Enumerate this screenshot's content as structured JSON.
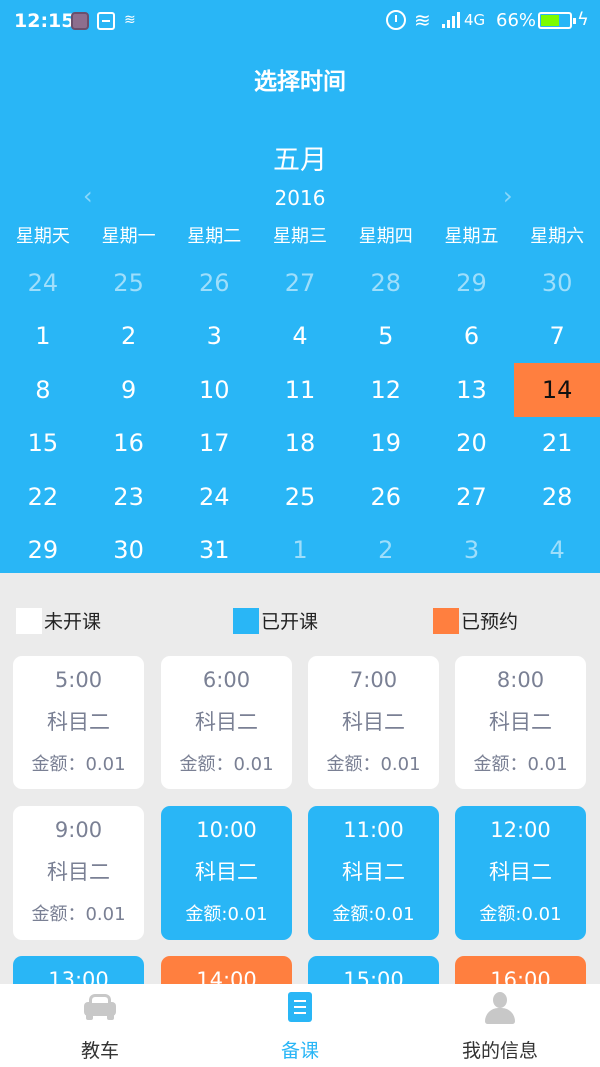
{
  "status_bar": {
    "time": "12:15",
    "network": "4G",
    "battery": "66%",
    "battery_level": 0.66
  },
  "header": {
    "title": "选择时间"
  },
  "calendar": {
    "month": "五月",
    "year": "2016",
    "prev": "‹",
    "next": "›",
    "weekdays": [
      "星期天",
      "星期一",
      "星期二",
      "星期三",
      "星期四",
      "星期五",
      "星期六"
    ],
    "weeks": [
      [
        {
          "d": "24",
          "other": true
        },
        {
          "d": "25",
          "other": true
        },
        {
          "d": "26",
          "other": true
        },
        {
          "d": "27",
          "other": true
        },
        {
          "d": "28",
          "other": true
        },
        {
          "d": "29",
          "other": true
        },
        {
          "d": "30",
          "other": true
        }
      ],
      [
        {
          "d": "1"
        },
        {
          "d": "2"
        },
        {
          "d": "3"
        },
        {
          "d": "4"
        },
        {
          "d": "5"
        },
        {
          "d": "6"
        },
        {
          "d": "7"
        }
      ],
      [
        {
          "d": "8"
        },
        {
          "d": "9"
        },
        {
          "d": "10"
        },
        {
          "d": "11"
        },
        {
          "d": "12"
        },
        {
          "d": "13"
        },
        {
          "d": "14",
          "selected": true
        }
      ],
      [
        {
          "d": "15"
        },
        {
          "d": "16"
        },
        {
          "d": "17"
        },
        {
          "d": "18"
        },
        {
          "d": "19"
        },
        {
          "d": "20"
        },
        {
          "d": "21"
        }
      ],
      [
        {
          "d": "22"
        },
        {
          "d": "23"
        },
        {
          "d": "24"
        },
        {
          "d": "25"
        },
        {
          "d": "26"
        },
        {
          "d": "27"
        },
        {
          "d": "28"
        }
      ],
      [
        {
          "d": "29"
        },
        {
          "d": "30"
        },
        {
          "d": "31"
        },
        {
          "d": "1",
          "other": true
        },
        {
          "d": "2",
          "other": true
        },
        {
          "d": "3",
          "other": true
        },
        {
          "d": "4",
          "other": true
        }
      ]
    ]
  },
  "legend": [
    {
      "label": "未开课",
      "color": "#ffffff"
    },
    {
      "label": "已开课",
      "color": "#29b6f6"
    },
    {
      "label": "已预约",
      "color": "#ff7f3f"
    }
  ],
  "slots": [
    {
      "time": "5:00",
      "subject": "科目二",
      "price": "金额：0.01",
      "state": "closed"
    },
    {
      "time": "6:00",
      "subject": "科目二",
      "price": "金额：0.01",
      "state": "closed"
    },
    {
      "time": "7:00",
      "subject": "科目二",
      "price": "金额：0.01",
      "state": "closed"
    },
    {
      "time": "8:00",
      "subject": "科目二",
      "price": "金额：0.01",
      "state": "closed"
    },
    {
      "time": "9:00",
      "subject": "科目二",
      "price": "金额：0.01",
      "state": "closed"
    },
    {
      "time": "10:00",
      "subject": "科目二",
      "price": "金额:0.01",
      "state": "open"
    },
    {
      "time": "11:00",
      "subject": "科目二",
      "price": "金额:0.01",
      "state": "open"
    },
    {
      "time": "12:00",
      "subject": "科目二",
      "price": "金额:0.01",
      "state": "open"
    },
    {
      "time": "13:00",
      "subject": "",
      "price": "",
      "state": "open"
    },
    {
      "time": "14:00",
      "subject": "",
      "price": "",
      "state": "booked"
    },
    {
      "time": "15:00",
      "subject": "",
      "price": "",
      "state": "open"
    },
    {
      "time": "16:00",
      "subject": "",
      "price": "",
      "state": "booked"
    }
  ],
  "tabs": [
    {
      "label": "教车",
      "icon": "car-icon",
      "active": false
    },
    {
      "label": "备课",
      "icon": "lesson-plan-icon",
      "active": true
    },
    {
      "label": "我的信息",
      "icon": "user-icon",
      "active": false
    }
  ],
  "colors": {
    "primary": "#29b6f6",
    "selected": "#ff7f3f",
    "background": "#ebebeb"
  }
}
